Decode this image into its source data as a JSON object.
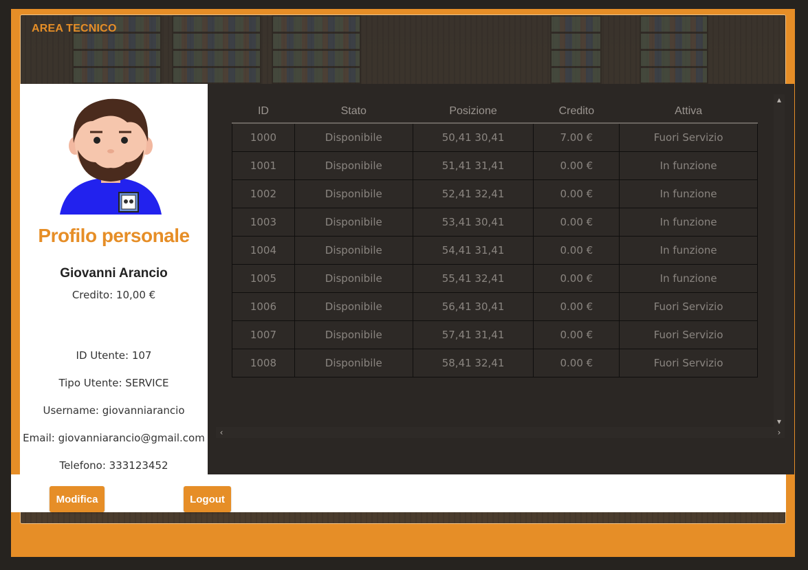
{
  "header": {
    "title": "AREA TECNICO"
  },
  "profile": {
    "title": "Profilo personale",
    "name": "Giovanni Arancio",
    "credit": "Credito: 10,00 €",
    "user_id": "ID Utente: 107",
    "user_type": "Tipo Utente: SERVICE",
    "username": "Username: giovanniarancio",
    "email": "Email: giovanniarancio@gmail.com",
    "phone": "Telefono: 333123452"
  },
  "buttons": {
    "modify": "Modifica",
    "logout": "Logout"
  },
  "table": {
    "columns": [
      "ID",
      "Stato",
      "Posizione",
      "Credito",
      "Attiva"
    ],
    "rows": [
      [
        "1000",
        "Disponibile",
        "50,41 30,41",
        "7.00 €",
        "Fuori Servizio"
      ],
      [
        "1001",
        "Disponibile",
        "51,41 31,41",
        "0.00 €",
        "In funzione"
      ],
      [
        "1002",
        "Disponibile",
        "52,41 32,41",
        "0.00 €",
        "In funzione"
      ],
      [
        "1003",
        "Disponibile",
        "53,41 30,41",
        "0.00 €",
        "In funzione"
      ],
      [
        "1004",
        "Disponibile",
        "54,41 31,41",
        "0.00 €",
        "In funzione"
      ],
      [
        "1005",
        "Disponibile",
        "55,41 32,41",
        "0.00 €",
        "In funzione"
      ],
      [
        "1006",
        "Disponibile",
        "56,41 30,41",
        "0.00 €",
        "Fuori Servizio"
      ],
      [
        "1007",
        "Disponibile",
        "57,41 31,41",
        "0.00 €",
        "Fuori Servizio"
      ],
      [
        "1008",
        "Disponibile",
        "58,41 32,41",
        "0.00 €",
        "Fuori Servizio"
      ]
    ]
  },
  "colors": {
    "accent": "#e68e27",
    "panel_dark": "#2b2724",
    "background": "#26231f"
  },
  "icons": {
    "avatar": "technician-avatar-icon",
    "scroll_up": "chevron-up-icon",
    "scroll_down": "chevron-down-icon",
    "scroll_left": "chevron-left-icon",
    "scroll_right": "chevron-right-icon"
  }
}
